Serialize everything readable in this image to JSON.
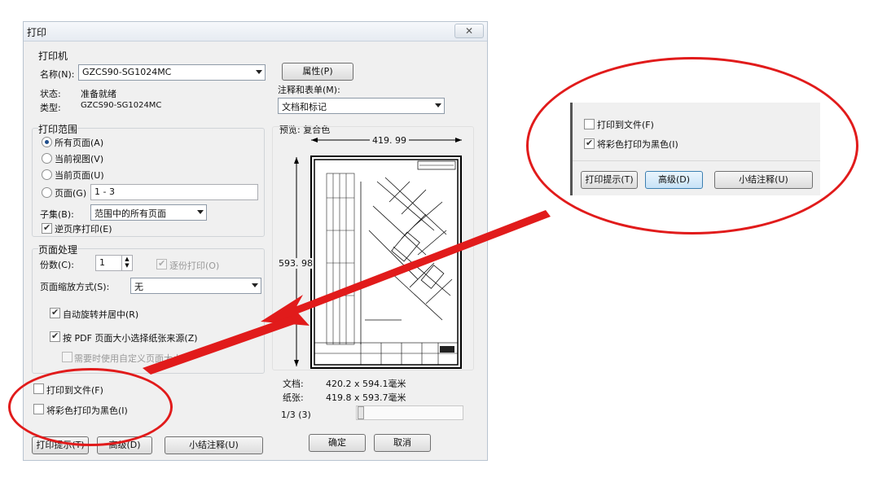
{
  "window": {
    "title": "打印",
    "close_glyph": "✕"
  },
  "printer": {
    "group_title": "打印机",
    "name_label": "名称(N):",
    "name_value": "GZCS90-SG1024MC",
    "properties_button": "属性(P)",
    "status_label": "状态:",
    "status_value": "准备就绪",
    "type_label": "类型:",
    "type_value": "GZCS90-SG1024MC",
    "comments_label": "注释和表单(M):",
    "comments_value": "文档和标记"
  },
  "print_range": {
    "group_title": "打印范围",
    "options": [
      "所有页面(A)",
      "当前视图(V)",
      "当前页面(U)",
      "页面(G)"
    ],
    "selected_index": 0,
    "pages_value": "1 - 3",
    "subset_label": "子集(B):",
    "subset_value": "范围中的所有页面",
    "reverse_label": "逆页序打印(E)",
    "reverse_checked": true
  },
  "page_handling": {
    "group_title": "页面处理",
    "copies_label": "份数(C):",
    "copies_value": "1",
    "collate_label": "逐份打印(O)",
    "scaling_label": "页面缩放方式(S):",
    "scaling_value": "无",
    "auto_rotate_label": "自动旋转并居中(R)",
    "auto_rotate_checked": true,
    "paper_by_pdf_label": "按 PDF 页面大小选择纸张来源(Z)",
    "paper_by_pdf_checked": true,
    "custom_size_label": "需要时使用自定义页面大小",
    "custom_size_checked": false
  },
  "output": {
    "print_to_file_label": "打印到文件(F)",
    "print_to_file_checked": false,
    "color_as_black_label": "将彩色打印为黑色(I)",
    "color_as_black_checked": false
  },
  "preview": {
    "label": "预览: 复合色",
    "width_dim": "419. 99",
    "height_dim": "593. 98",
    "doc_label": "文档:",
    "doc_value": "420.2 x 594.1毫米",
    "paper_label": "纸张:",
    "paper_value": "419.8 x 593.7毫米",
    "page_indicator": "1/3 (3)"
  },
  "buttons": {
    "print_tips": "打印提示(T)",
    "advanced": "高级(D)",
    "summarize_comments": "小结注释(U)",
    "ok": "确定",
    "cancel": "取消"
  },
  "callout": {
    "print_to_file_label": "打印到文件(F)",
    "print_to_file_checked": false,
    "color_as_black_label": "将彩色打印为黑色(I)",
    "color_as_black_checked": true,
    "print_tips": "打印提示(T)",
    "advanced": "高级(D)",
    "summarize_comments": "小结注释(U)"
  },
  "colors": {
    "annotation_red": "#e11b1b",
    "dialog_bg": "#f0f0f0",
    "radio_dot": "#1f4e8c"
  }
}
